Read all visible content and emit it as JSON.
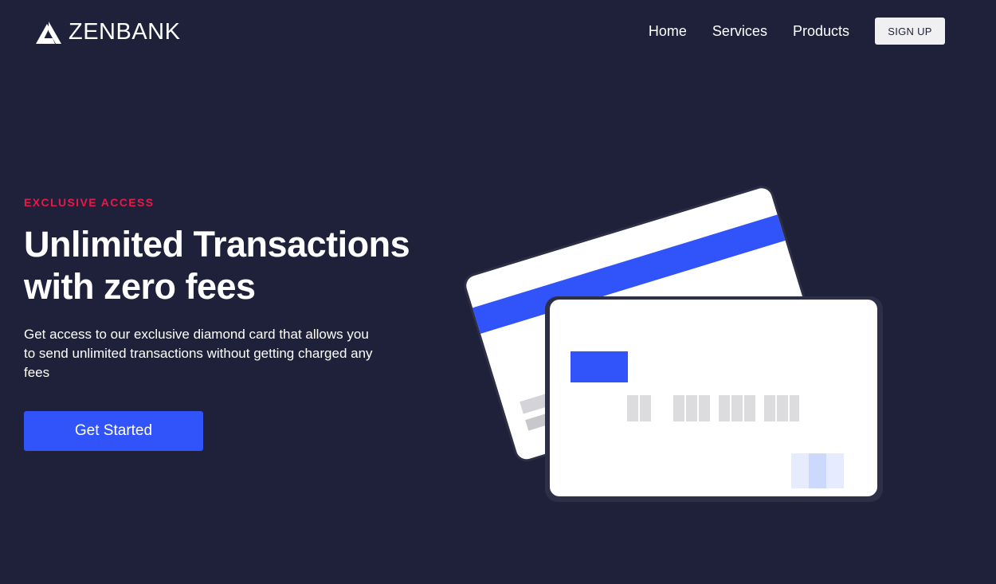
{
  "brand": {
    "name": "ZENBANK",
    "logo_icon": "stylized-a-icon"
  },
  "nav": {
    "items": [
      {
        "label": "Home"
      },
      {
        "label": "Services"
      },
      {
        "label": "Products"
      }
    ],
    "signup_label": "SIGN UP"
  },
  "hero": {
    "eyebrow": "EXCLUSIVE ACCESS",
    "headline_line1": "Unlimited Transactions",
    "headline_line2": "with zero fees",
    "subtext": "Get access to our exclusive diamond card that allows you to send unlimited transactions without getting charged any fees",
    "cta_label": "Get Started"
  },
  "colors": {
    "background": "#1e2139",
    "accent": "#3054fa",
    "eyebrow": "#e8194a",
    "card": "#ffffff"
  }
}
